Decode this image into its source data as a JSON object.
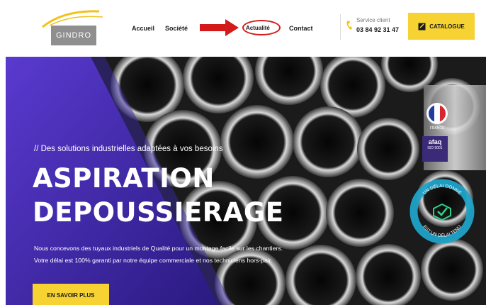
{
  "brand": {
    "logo_text": "GINDRO"
  },
  "nav": {
    "items": [
      "Accueil",
      "Société",
      "Actualité",
      "Contact"
    ]
  },
  "service": {
    "label": "Service client",
    "phone": "03 84 92 31 47"
  },
  "catalogue": {
    "label": "CATALOGUE"
  },
  "hero": {
    "tagline": "// Des solutions industrielles adaptées à vos besoins",
    "title_line1": "ASPIRATION",
    "title_line2": "DEPOUSSIERAGE",
    "desc_line1": "Nous concevons des tuyaux industriels de Qualité pour un montage facile sur les chantiers.",
    "desc_line2": "Votre délai est 100% garanti par notre équipe commerciale et nos techniciens hors-pair.",
    "cta": "EN SAVOIR PLUS"
  },
  "badges": {
    "france": "FRANCE",
    "afaq_title": "afaq",
    "afaq_sub": "ISO 9001",
    "delai_top": "UN DÉLAI DONNÉ",
    "delai_bottom": "EST UN DÉLAI TENU"
  },
  "colors": {
    "accent": "#f6d233",
    "purple": "#4a2fb8",
    "annotation": "#d31a1a"
  }
}
